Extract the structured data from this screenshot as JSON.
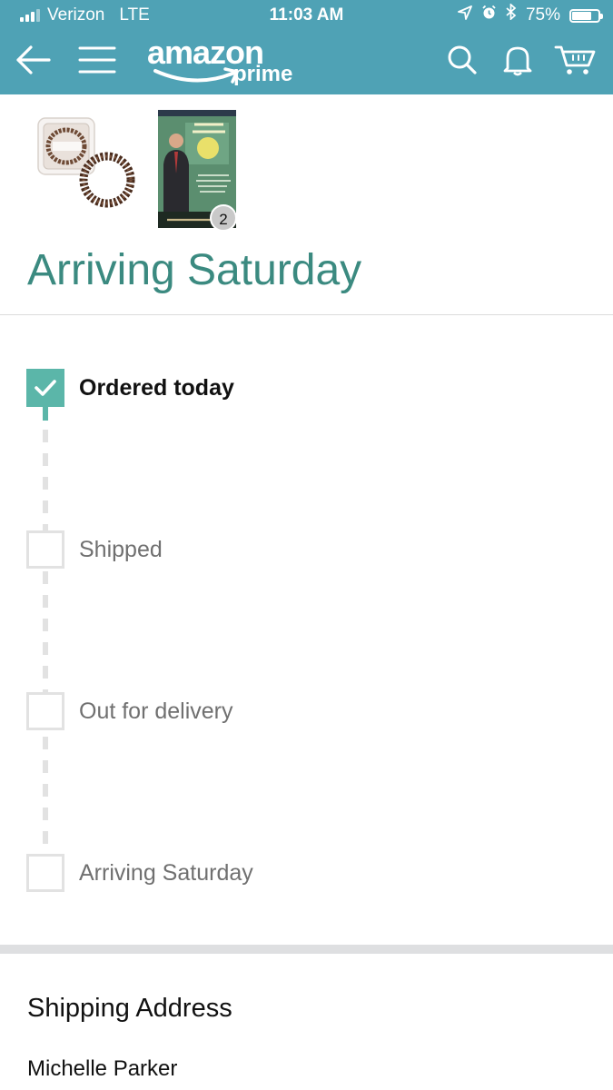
{
  "status_bar": {
    "carrier": "Verizon",
    "network": "LTE",
    "time": "11:03 AM",
    "battery_percent": "75%",
    "battery_level": 0.75,
    "icons": [
      "location-arrow-icon",
      "alarm-icon",
      "bluetooth-icon",
      "battery-icon"
    ]
  },
  "nav": {
    "back_icon": "back-arrow-icon",
    "menu_icon": "hamburger-menu-icon",
    "logo_primary": "amazon",
    "logo_secondary": "prime",
    "search_icon": "search-icon",
    "notifications_icon": "bell-icon",
    "cart_icon": "cart-icon"
  },
  "order": {
    "items": [
      {
        "image": "hair-tie-product-image"
      },
      {
        "image": "book-cover-image",
        "quantity": "2"
      }
    ],
    "arrival_title": "Arriving Saturday"
  },
  "tracking": {
    "steps": [
      {
        "label": "Ordered today",
        "completed": true
      },
      {
        "label": "Shipped",
        "completed": false
      },
      {
        "label": "Out for delivery",
        "completed": false
      },
      {
        "label": "Arriving Saturday",
        "completed": false
      }
    ]
  },
  "shipping": {
    "title": "Shipping Address",
    "name": "Michelle Parker"
  },
  "colors": {
    "header": "#4fa2b5",
    "accent": "#3b8a80",
    "check": "#5bb6a9",
    "inactive": "#e2e2e2"
  }
}
